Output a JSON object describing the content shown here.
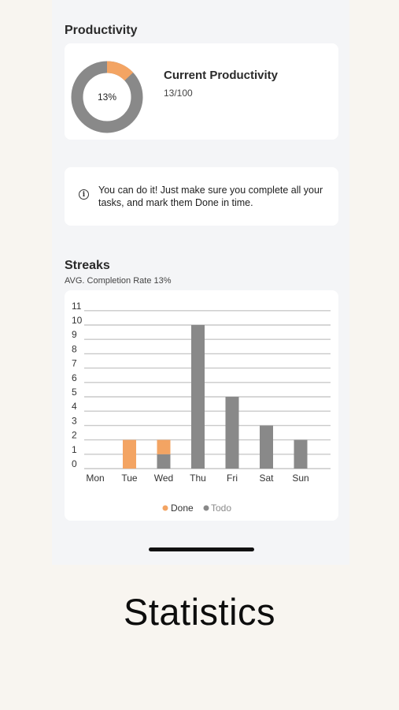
{
  "productivity": {
    "section_title": "Productivity",
    "percent_label": "13%",
    "percent_value": 13,
    "card_title": "Current Productivity",
    "score": "13/100"
  },
  "info": {
    "icon": "info-icon",
    "message": "You can do it! Just make sure you complete all your tasks, and mark them Done in time."
  },
  "streaks": {
    "section_title": "Streaks",
    "avg_label": "AVG. Completion Rate 13%"
  },
  "colors": {
    "done": "#f3a463",
    "todo": "#898989",
    "card": "#ffffff",
    "screen_bg": "#f4f5f7",
    "page_bg": "#f8f5f0"
  },
  "chart_data": {
    "type": "bar",
    "stacked": true,
    "categories": [
      "Mon",
      "Tue",
      "Wed",
      "Thu",
      "Fri",
      "Sat",
      "Sun"
    ],
    "series": [
      {
        "name": "Done",
        "values": [
          0,
          2,
          1,
          0,
          0,
          0,
          0
        ]
      },
      {
        "name": "Todo",
        "values": [
          0,
          0,
          1,
          10,
          5,
          3,
          2
        ]
      }
    ],
    "yticks": [
      0,
      1,
      2,
      3,
      4,
      5,
      6,
      7,
      8,
      9,
      10,
      11
    ],
    "ylim": [
      0,
      11
    ],
    "grid": true,
    "legend": "bottom-center"
  },
  "caption": "Statistics"
}
